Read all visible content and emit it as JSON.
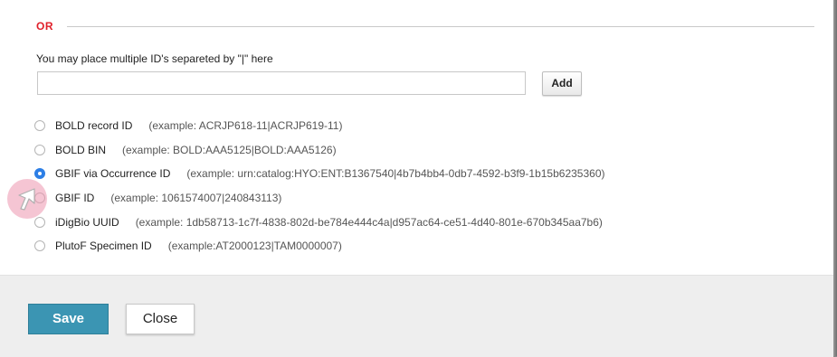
{
  "or_label": "OR",
  "hint": "You may place multiple ID's separeted by \"|\" here",
  "id_input": {
    "value": "",
    "placeholder": ""
  },
  "add_label": "Add",
  "options": [
    {
      "label": "BOLD record ID",
      "example": "(example: ACRJP618-11|ACRJP619-11)",
      "checked": false
    },
    {
      "label": "BOLD BIN",
      "example": "(example: BOLD:AAA5125|BOLD:AAA5126)",
      "checked": false
    },
    {
      "label": "GBIF via Occurrence ID",
      "example": "(example: urn:catalog:HYO:ENT:B1367540|4b7b4bb4-0db7-4592-b3f9-1b15b6235360)",
      "checked": true
    },
    {
      "label": "GBIF ID",
      "example": "(example: 1061574007|240843113)",
      "checked": false
    },
    {
      "label": "iDigBio UUID",
      "example": "(example: 1db58713-1c7f-4838-802d-be784e444c4a|d957ac64-ce51-4d40-801e-670b345aa7b6)",
      "checked": false
    },
    {
      "label": "PlutoF Specimen ID",
      "example": "(example:AT2000123|TAM0000007)",
      "checked": false
    }
  ],
  "save_label": "Save",
  "close_label": "Close",
  "colors": {
    "accent": "#3b95b3",
    "or_red": "#e0202a",
    "radio_checked": "#2d7fe6",
    "cursor_halo": "#ec96af"
  },
  "cursor_icon": "pointer-arrow-icon"
}
